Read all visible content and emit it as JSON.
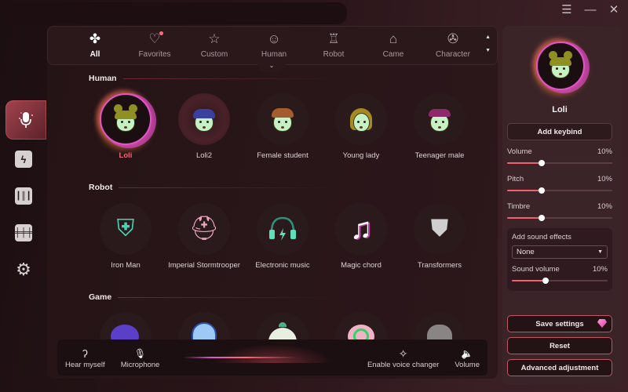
{
  "window": {
    "controls": [
      {
        "name": "menu-icon",
        "glyph": "☰"
      },
      {
        "name": "minimize-icon",
        "glyph": "—"
      },
      {
        "name": "close-icon",
        "glyph": "✕"
      }
    ]
  },
  "sidebar": {
    "items": [
      {
        "name": "voice-changer",
        "icon": "microphone-icon",
        "active": true
      },
      {
        "name": "soundboard",
        "icon": "lightning-icon",
        "active": false
      },
      {
        "name": "audio-library",
        "icon": "waveform-icon",
        "active": false
      },
      {
        "name": "equalizer",
        "icon": "sliders-icon",
        "active": false
      },
      {
        "name": "settings",
        "icon": "gear-icon",
        "active": false
      }
    ]
  },
  "tabs": [
    {
      "label": "All",
      "icon": "clover-icon",
      "glyph": "✤",
      "active": true
    },
    {
      "label": "Favorites",
      "icon": "heart-icon",
      "glyph": "♡",
      "active": false,
      "badge": true
    },
    {
      "label": "Custom",
      "icon": "star-wand-icon",
      "glyph": "☆",
      "active": false
    },
    {
      "label": "Human",
      "icon": "person-icon",
      "glyph": "☺",
      "active": false
    },
    {
      "label": "Robot",
      "icon": "robot-icon",
      "glyph": "♖",
      "active": false
    },
    {
      "label": "Came",
      "icon": "gamepad-icon",
      "glyph": "⌂",
      "active": false
    },
    {
      "label": "Character",
      "icon": "film-reel-icon",
      "glyph": "✇",
      "active": false
    }
  ],
  "tab_scroll": {
    "up": "▲",
    "down": "▼"
  },
  "collapse_glyph": "⌄",
  "sections": {
    "human": {
      "title": "Human",
      "voices": [
        {
          "name": "Loli",
          "selected": true
        },
        {
          "name": "Loli2",
          "selected": false
        },
        {
          "name": "Female student",
          "selected": false
        },
        {
          "name": "Young lady",
          "selected": false
        },
        {
          "name": "Teenager male",
          "selected": false
        }
      ]
    },
    "robot": {
      "title": "Robot",
      "voices": [
        {
          "name": "Iron Man",
          "glyph": "⛨"
        },
        {
          "name": "Imperial Stormtrooper",
          "glyph": "⛑"
        },
        {
          "name": "Electronic music",
          "glyph": "🎧"
        },
        {
          "name": "Magic chord",
          "glyph": "♫"
        },
        {
          "name": "Transformers",
          "glyph": "⛊"
        }
      ]
    },
    "game": {
      "title": "Game"
    }
  },
  "bottom_bar": {
    "hear_myself": {
      "label": "Hear myself",
      "glyph": "ʔ"
    },
    "microphone": {
      "label": "Microphone",
      "glyph": "🎙"
    },
    "enable_voice_changer": {
      "label": "Enable voice changer",
      "glyph": "✧"
    },
    "volume": {
      "label": "Volume",
      "glyph": "🔈"
    }
  },
  "right_panel": {
    "selected_voice": "Loli",
    "add_keybind": "Add keybind",
    "sliders": [
      {
        "label": "Volume",
        "value_text": "10%",
        "fraction": 0.33
      },
      {
        "label": "Pitch",
        "value_text": "10%",
        "fraction": 0.33
      },
      {
        "label": "Timbre",
        "value_text": "10%",
        "fraction": 0.33
      }
    ],
    "effects": {
      "label": "Add sound effects",
      "selected": "None",
      "caret": "▼",
      "sound_volume": {
        "label": "Sound volume",
        "value_text": "10%",
        "fraction": 0.35
      }
    },
    "buttons": {
      "save": "Save settings",
      "reset": "Reset",
      "advanced": "Advanced adjustment"
    }
  },
  "colors": {
    "accent": "#f0606f",
    "selected_ring": "#e253c8",
    "selected_label": "#f06a7e"
  }
}
